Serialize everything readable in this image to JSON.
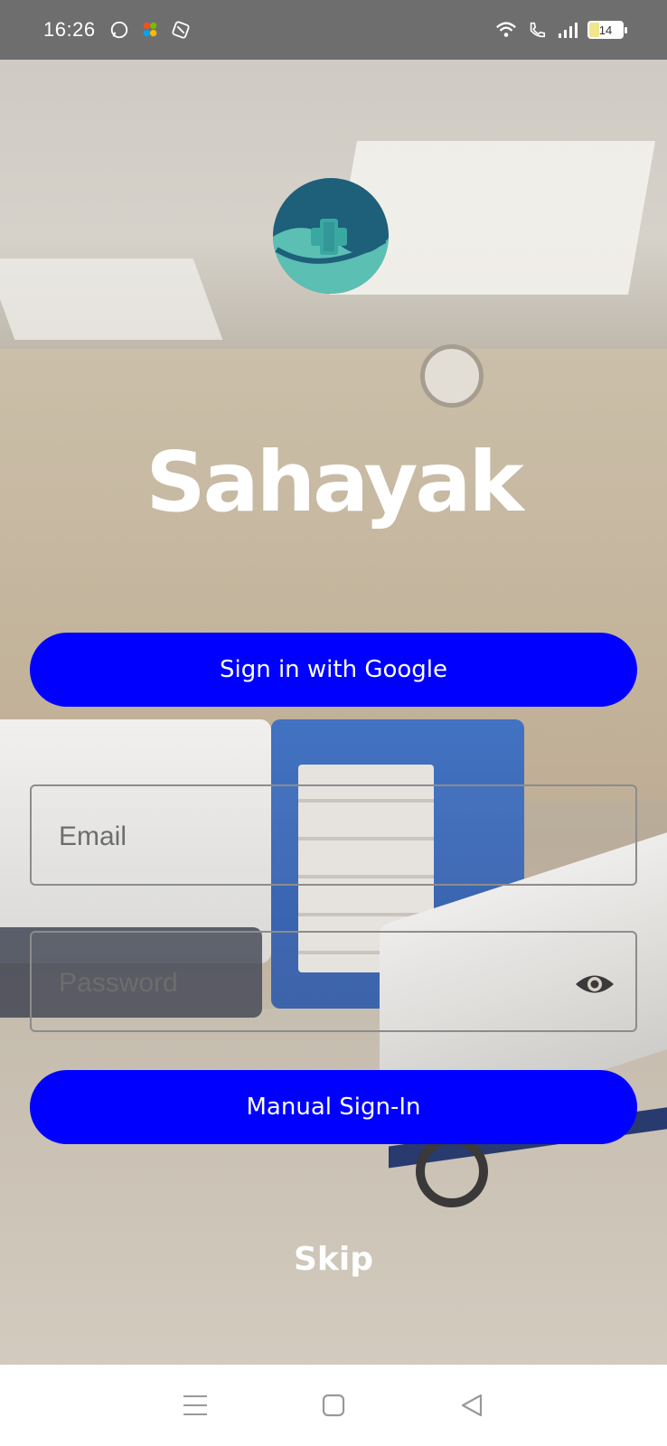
{
  "status_bar": {
    "time": "16:26",
    "battery": "14",
    "icons": [
      "whatsapp-icon",
      "microsoft-icon",
      "app-icon",
      "wifi-icon",
      "wifi-call-icon",
      "signal-icon",
      "battery-icon"
    ]
  },
  "app": {
    "title": "Sahayak",
    "logo": "sahayak-logo"
  },
  "buttons": {
    "google_sign_in": "Sign in with Google",
    "manual_sign_in": "Manual Sign-In",
    "skip": "Skip"
  },
  "form": {
    "email_placeholder": "Email",
    "password_placeholder": "Password"
  },
  "nav_bar": {
    "buttons": [
      "menu-icon",
      "home-icon",
      "back-icon"
    ]
  },
  "colors": {
    "primary_button": "#0000ff",
    "logo_dark": "#1e5f7a",
    "logo_teal": "#5bbfb3",
    "status_bar": "#6e6e6e"
  }
}
